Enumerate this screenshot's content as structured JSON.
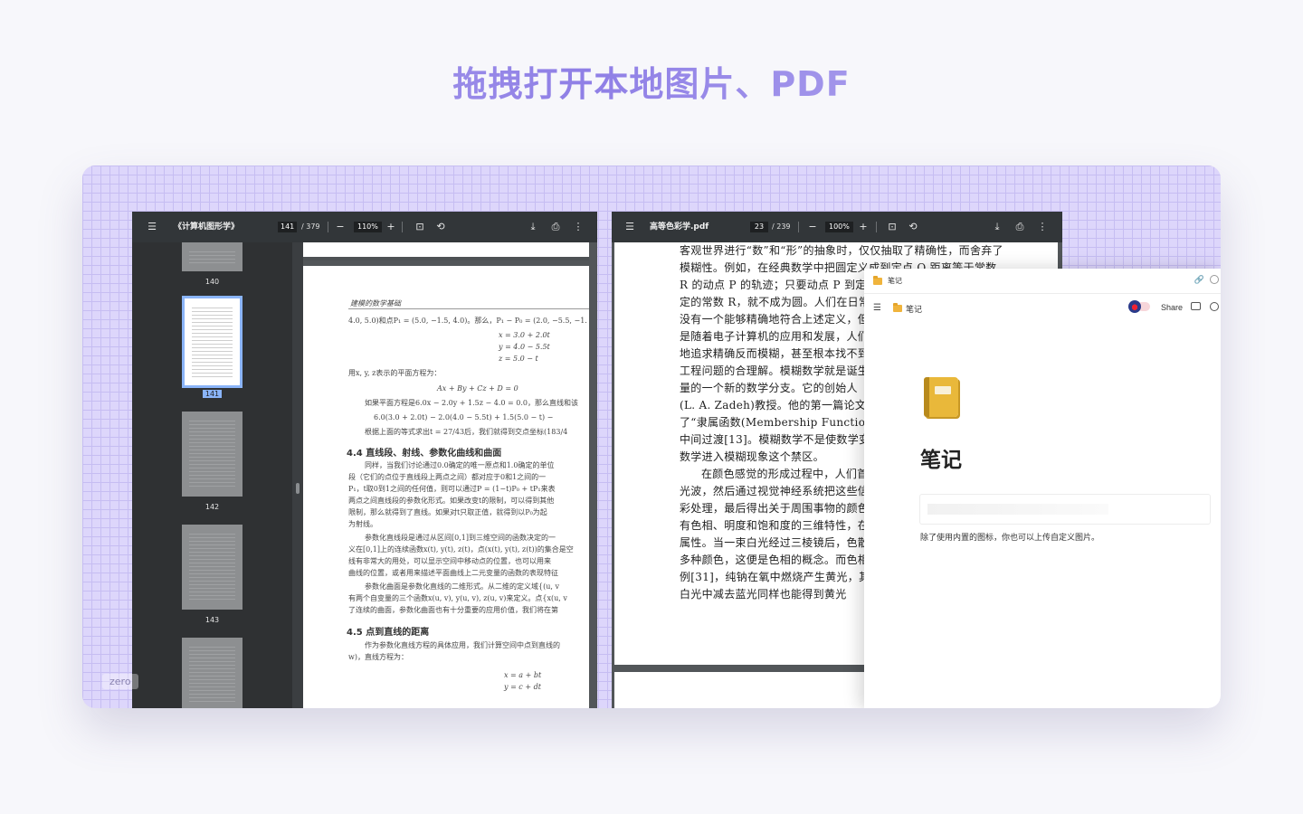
{
  "headline": "拖拽打开本地图片、PDF",
  "stage_badge": "zero",
  "viewer_a": {
    "menu_icon": "hamburger-menu-icon",
    "title": "《计算机图形学》",
    "page_current": "141",
    "page_total": "/ 379",
    "zoom": "110%",
    "zoom_out": "−",
    "zoom_in": "+",
    "thumbnails": [
      {
        "label": "140"
      },
      {
        "label": "141"
      },
      {
        "label": "142"
      },
      {
        "label": "143"
      }
    ],
    "page": {
      "running_head": "建模的数学基础",
      "lines": [
        "4.0, 5.0)和点P₁ = (5.0, −1.5, 4.0)。那么，P₁ − P₀ = (2.0, −5.5, −1.",
        "x = 3.0 + 2.0t",
        "y = 4.0 − 5.5t",
        "z = 5.0 − t",
        "用x, y, z表示的平面方程为：",
        "Ax + By + Cz + D = 0",
        "如果平面方程是6.0x − 2.0y + 1.5z − 4.0 = 0.0，那么直线和该",
        "6.0(3.0 + 2.0t) − 2.0(4.0 − 5.5t) + 1.5(5.0 − t) −",
        "根据上面的等式求出t = 27/43后，我们就得到交点坐标(183/4",
        "4.4  直线段、射线、参数化曲线和曲面",
        "同样，当我们讨论通过0.0确定的唯一原点和1.0确定的单位",
        "段（它们的点位于直线段上两点之间）都对应于0和1之间的一",
        "P₁，t取0到1之间的任何值，则可以通过P = (1−t)P₀ + tP₁来表",
        "两点之间直线段的参数化形式。如果改变t的限制，可以得到其他",
        "限制，那么就得到了直线。如果对t只取正值，就得到以P₀为起",
        "为射线。",
        "参数化直线段是通过从区间[0,1]到三维空间的函数决定的一",
        "义在[0,1]上的连续函数x(t), y(t), z(t)，点(x(t), y(t), z(t))的集合是空",
        "线有非常大的用处，可以显示空间中移动点的位置，也可以用来",
        "曲线的位置，或者用来描述平面曲线上二元变量的函数的表现特征",
        "参数化曲面是参数化直线的二维形式。从二维的定义域{(u, v",
        "有两个自变量的三个函数x(u, v), y(u, v), z(u, v)来定义。点{x(u, v",
        "了连续的曲面，参数化曲面也有十分重要的应用价值，我们将在第",
        "4.5  点到直线的距离",
        "作为参数化直线方程的具体应用，我们计算空间中点到直线的",
        "w)，直线方程为：",
        "x = a + bt",
        "y = c + dt"
      ]
    }
  },
  "viewer_b": {
    "menu_icon": "hamburger-menu-icon",
    "title": "高等色彩学.pdf",
    "page_current": "23",
    "page_total": "/ 239",
    "zoom": "100%",
    "zoom_out": "−",
    "zoom_in": "+",
    "page": {
      "lines": [
        "客观世界进行“数”和“形”的抽象时，仅仅抽取了精确性，而舍弃了",
        "模糊性。例如，在经典数学中把圆定义成到定点 O 距离等于常数",
        "R 的动点 P 的轨迹；只要动点 P 到定点",
        "定的常数 R，就不成为圆。人们在日常生",
        "没有一个能够精确地符合上述定义，但",
        "是随着电子计算机的应用和发展，人们",
        "地追求精确反而模糊，甚至根本找不到",
        "工程问题的合理解。模糊数学就是诞生",
        "量的一个新的数学分支。它的创始人",
        "(L. A. Zadeh)教授。他的第一篇论文“",
        "了“隶属函数(Membership Function)”的",
        "中间过渡[13]。模糊数学不是使数学变",
        "数学进入模糊现象这个禁区。",
        "在颜色感觉的形成过程中，人们首",
        "光波，然后通过视觉神经系统把这些信",
        "彩处理，最后得出关于周围事物的颜色",
        "有色相、明度和饱和度的三维特性，在补",
        "属性。当一束白光经过三棱镜后，色散成",
        "多种颜色，这便是色相的概念。而色相补",
        "例[31]，纯钠在氧中燃烧产生黄光，其波",
        "白光中减去蓝光同样也能得到黄光"
      ]
    }
  },
  "notes": {
    "window_title": "笔记",
    "breadcrumb": "笔记",
    "share_label": "Share",
    "page_title": "笔记",
    "caption": "除了使用内置的图标，你也可以上传自定义图片。",
    "icons": {
      "menu": "hamburger-menu-icon",
      "link": "link-icon",
      "comment": "comment-icon",
      "history": "history-icon",
      "page_icon": "notebook-icon"
    }
  }
}
